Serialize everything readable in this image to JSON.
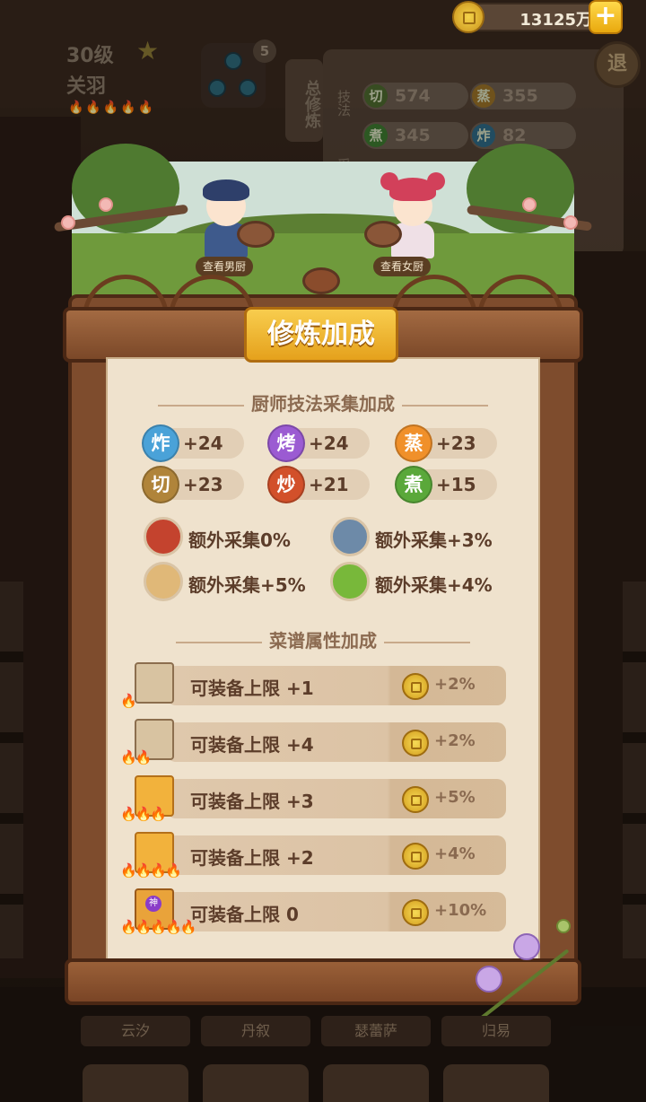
{
  "hud": {
    "level": "30级",
    "hero_name": "关羽",
    "coin_amount": "13125万",
    "add_button": "+",
    "slot_count": "5",
    "total_train": "总修炼",
    "tech_label": "技法",
    "collect_label": "采",
    "exit_label": "退",
    "stats": [
      {
        "icon_char": "切",
        "value": "574",
        "color": "#6a7d3a"
      },
      {
        "icon_char": "蒸",
        "value": "355",
        "color": "#b07a2a"
      },
      {
        "icon_char": "煮",
        "value": "345",
        "color": "#4a8a3a"
      },
      {
        "icon_char": "炸",
        "value": "82",
        "color": "#3d7fa0"
      }
    ]
  },
  "scene": {
    "male_chef_label": "查看男厨",
    "female_chef_label": "查看女厨"
  },
  "panel": {
    "title": "修炼加成",
    "section1": "厨师技法采集加成",
    "skills": [
      {
        "icon_char": "炸",
        "value": "+24",
        "color": "#4aa2d8"
      },
      {
        "icon_char": "烤",
        "value": "+24",
        "color": "#9b5bd2"
      },
      {
        "icon_char": "蒸",
        "value": "+23",
        "color": "#f0902a"
      },
      {
        "icon_char": "切",
        "value": "+23",
        "color": "#b0843a"
      },
      {
        "icon_char": "炒",
        "value": "+21",
        "color": "#d2502a"
      },
      {
        "icon_char": "煮",
        "value": "+15",
        "color": "#5aa83a"
      }
    ],
    "extras": [
      {
        "icon": "meat-icon",
        "text": "额外采集0%",
        "color": "#c4432e"
      },
      {
        "icon": "fish-icon",
        "text": "额外采集+3%",
        "color": "#6d8aa8"
      },
      {
        "icon": "flour-icon",
        "text": "额外采集+5%",
        "color": "#e0b878"
      },
      {
        "icon": "vegetable-icon",
        "text": "额外采集+4%",
        "color": "#78b83a"
      }
    ],
    "section2": "菜谱属性加成",
    "recipes": [
      {
        "text": "可装备上限 +1",
        "pct": "+2%",
        "flames": "🔥",
        "tier": "plain"
      },
      {
        "text": "可装备上限 +4",
        "pct": "+2%",
        "flames": "🔥🔥",
        "tier": "plain"
      },
      {
        "text": "可装备上限 +3",
        "pct": "+5%",
        "flames": "🔥🔥🔥",
        "tier": "gold"
      },
      {
        "text": "可装备上限 +2",
        "pct": "+4%",
        "flames": "🔥🔥🔥🔥",
        "tier": "gold"
      },
      {
        "text": "可装备上限 0",
        "pct": "+10%",
        "flames": "🔥🔥🔥🔥🔥",
        "tier": "purple",
        "badge": "神"
      }
    ]
  },
  "bottom": {
    "names": [
      "云汐",
      "丹叙",
      "瑟蕾萨",
      "归易"
    ]
  }
}
